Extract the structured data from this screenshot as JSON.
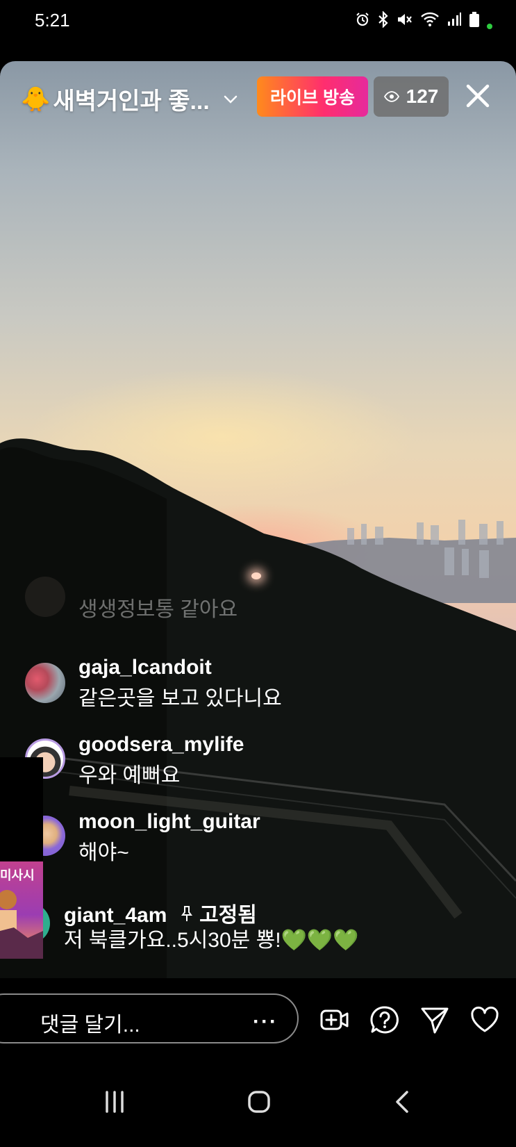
{
  "status_bar": {
    "time": "5:21",
    "icons": [
      "alarm-icon",
      "bluetooth-icon",
      "mute-icon",
      "wifi-icon",
      "signal-icon",
      "battery-icon"
    ]
  },
  "live": {
    "title": "새벽거인과 좋...",
    "title_emoji": "🐥",
    "badge_label": "라이브 방송",
    "viewer_count": "127"
  },
  "comments": [
    {
      "username": "",
      "text": "생생정보통 같아요",
      "faded": true
    },
    {
      "username": "gaja_lcandoit",
      "text": "같은곳을 보고 있다니요"
    },
    {
      "username": "goodsera_mylife",
      "text": "우와 예뻐요"
    },
    {
      "username": "moon_light_guitar",
      "text": "해야~"
    },
    {
      "username": "giant_4am",
      "pinned_label": "고정됨",
      "text": "저 북클가요..5시30분 뿅!💚💚💚"
    }
  ],
  "pip": {
    "text": "미사시"
  },
  "input": {
    "placeholder": "댓글 달기...",
    "more_label": "···"
  },
  "colors": {
    "live_gradient_start": "#ff8a1c",
    "live_gradient_end": "#e62a9c",
    "viewer_badge_bg": "#6e6e6e"
  }
}
